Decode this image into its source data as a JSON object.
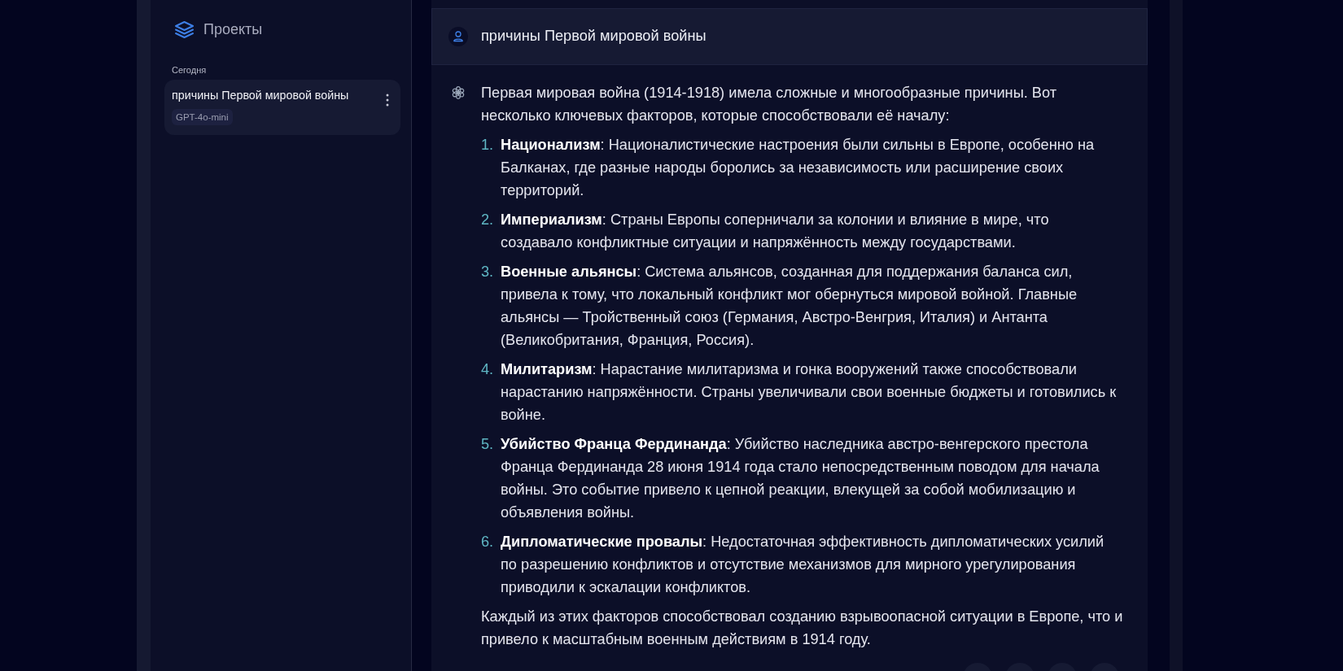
{
  "sidebar": {
    "title": "Проекты",
    "section_label": "Сегодня",
    "chats": [
      {
        "title": "причины Первой мировой войны",
        "model": "GPT-4o-mini",
        "selected": true
      }
    ]
  },
  "conversation": {
    "user_message": "причины Первой мировой войны",
    "assistant_message": {
      "intro": "Первая мировая война (1914-1918) имела сложные и многообразные причины. Вот несколько ключевых факторов, которые способствовали её началу:",
      "items": [
        {
          "number": "1.",
          "text": "**Национализм**: Националистические настроения были сильны в Европе, особенно на Балканах, где разные народы боролись за независимость или расширение своих территорий."
        },
        {
          "number": "2.",
          "text": "**Империализм**: Страны Европы соперничали за колонии и влияние в мире, что создавало конфликтные ситуации и напряжённость между государствами."
        },
        {
          "number": "3.",
          "text": "**Военные альянсы**: Система альянсов, созданная для поддержания баланса сил, привела к тому, что локальный конфликт мог обернуться мировой войной. Главные альянсы — Тройственный союз (Германия, Австро-Венгрия, Италия) и Антанта (Великобритания, Франция, Россия)."
        },
        {
          "number": "4.",
          "text": "**Милитаризм**: Нарастание милитаризма и гонка вооружений также способствовали нарастанию напряжённости. Страны увеличивали свои военные бюджеты и готовились к войне."
        },
        {
          "number": "5.",
          "text": "**Убийство Франца Фердинанда**: Убийство наследника австро-венгерского престола Франца Фердинанда 28 июня 1914 года стало непосредственным поводом для начала войны. Это событие привело к цепной реакции, влекущей за собой мобилизацию и объявления войны."
        },
        {
          "number": "6.",
          "text": "**Дипломатические провалы**: Недостаточная эффективность дипломатических усилий по разрешению конфликтов и отсутствие механизмов для мирного урегулирования приводили к эскалации конфликтов."
        }
      ],
      "conclusion": "Каждый из этих факторов способствовал созданию взрывоопасной ситуации в Европе, что и привело к масштабным военным действиям в 1914 году."
    }
  }
}
